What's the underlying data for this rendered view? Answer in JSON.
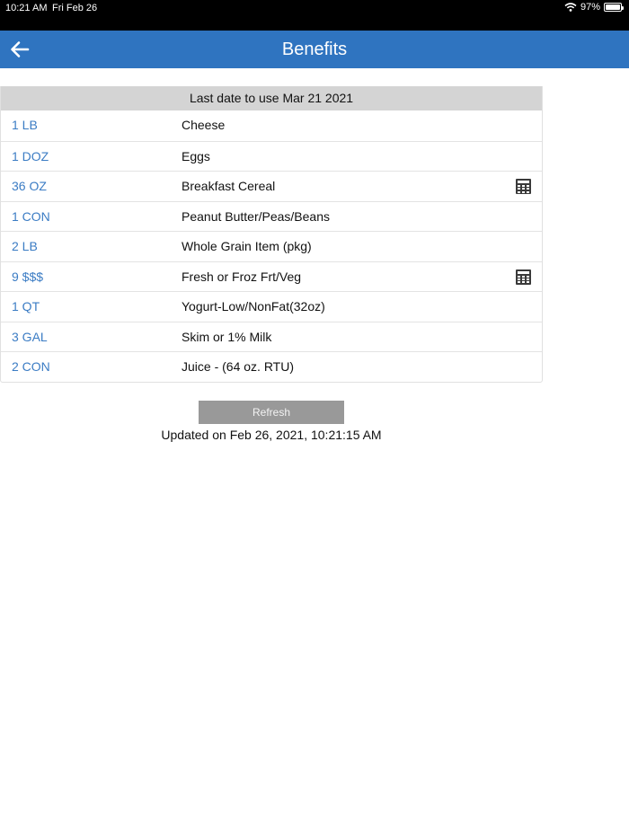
{
  "status_bar": {
    "time": "10:21 AM",
    "date": "Fri Feb 26",
    "battery": "97%",
    "battery_level": 0.97
  },
  "nav": {
    "title": "Benefits",
    "back_icon": "arrow-left-icon"
  },
  "card": {
    "header": "Last date to use Mar 21 2021",
    "items": [
      {
        "qty": "1 LB",
        "name": "Cheese",
        "calculator": false
      },
      {
        "qty": "1 DOZ",
        "name": "Eggs",
        "calculator": false
      },
      {
        "qty": "36 OZ",
        "name": "Breakfast Cereal",
        "calculator": true
      },
      {
        "qty": "1 CON",
        "name": "Peanut Butter/Peas/Beans",
        "calculator": false
      },
      {
        "qty": "2 LB",
        "name": "Whole Grain Item (pkg)",
        "calculator": false
      },
      {
        "qty": "9 $$$",
        "name": "Fresh or Froz Frt/Veg",
        "calculator": true
      },
      {
        "qty": "1 QT",
        "name": "Yogurt-Low/NonFat(32oz)",
        "calculator": false
      },
      {
        "qty": "3 GAL",
        "name": "Skim or 1% Milk",
        "calculator": false
      },
      {
        "qty": "2 CON",
        "name": "Juice - (64 oz. RTU)",
        "calculator": false
      }
    ]
  },
  "refresh_label": "Refresh",
  "updated_text": "Updated on Feb 26, 2021, 10:21:15 AM",
  "colors": {
    "nav_bg": "#2f74c0",
    "qty_text": "#3b7cc4",
    "header_bg": "#d4d4d4",
    "button_bg": "#999999"
  }
}
